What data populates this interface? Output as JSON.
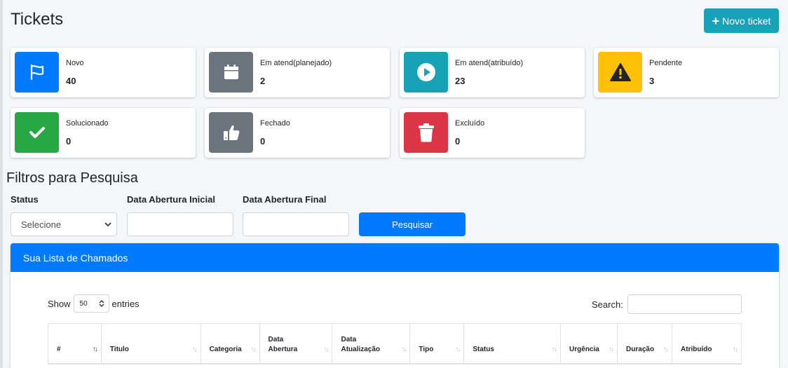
{
  "page": {
    "title": "Tickets",
    "new_ticket_label": "Novo ticket"
  },
  "status_boxes": [
    {
      "label": "Novo",
      "count": "40",
      "color": "#007bff",
      "icon": "flag-icon"
    },
    {
      "label": "Em atend(planejado)",
      "count": "2",
      "color": "#6c757d",
      "icon": "calendar-icon"
    },
    {
      "label": "Em atend(atribuído)",
      "count": "23",
      "color": "#17a2b8",
      "icon": "play-circle-icon"
    },
    {
      "label": "Pendente",
      "count": "3",
      "color": "#ffc107",
      "icon": "warning-icon"
    },
    {
      "label": "Solucionado",
      "count": "0",
      "color": "#28a745",
      "icon": "check-icon"
    },
    {
      "label": "Fechado",
      "count": "0",
      "color": "#6c757d",
      "icon": "thumbs-up-icon"
    },
    {
      "label": "Excluído",
      "count": "0",
      "color": "#dc3545",
      "icon": "trash-icon"
    }
  ],
  "filters": {
    "title": "Filtros para Pesquisa",
    "status_label": "Status",
    "status_value": "Selecione",
    "date_start_label": "Data Abertura Inicial",
    "date_start_value": "",
    "date_end_label": "Data Abertura Final",
    "date_end_value": "",
    "search_button": "Pesquisar"
  },
  "ticket_list": {
    "header": "Sua Lista de Chamados",
    "show_label": "Show",
    "entries_value": "50",
    "entries_label": "entries",
    "search_label": "Search:",
    "search_value": "",
    "columns": [
      "#",
      "Titulo",
      "Categoria",
      "Data Abertura",
      "Data Atualização",
      "Tipo",
      "Status",
      "Urgência",
      "Duração",
      "Atribuído"
    ]
  }
}
